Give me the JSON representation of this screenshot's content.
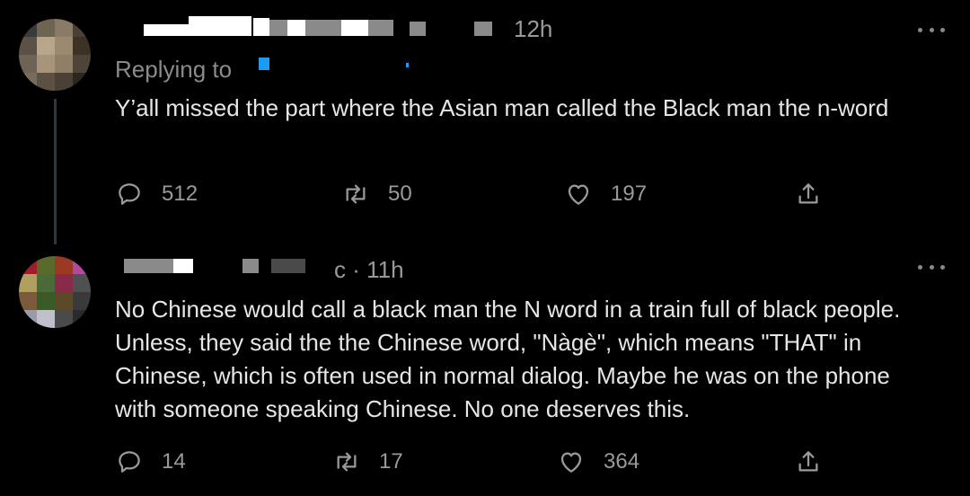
{
  "colors": {
    "background": "#000000",
    "text": "#e6e6e6",
    "muted": "#9a9a9a",
    "accent": "#1d9bf0"
  },
  "tweets": [
    {
      "time": "12h",
      "replying_to": "Replying to",
      "text": "Y’all missed the part where the Asian man called the Black man the n-word",
      "actions": {
        "replies": "512",
        "retweets": "50",
        "likes": "197"
      }
    },
    {
      "time": "c · 11h",
      "text": "No Chinese would call a black man the N word in a train full of black people.  Unless, they said the the Chinese word, \"Nàgè\", which means \"THAT\" in Chinese, which is often used in normal dialog. Maybe he was on the phone with someone speaking Chinese.  No one deserves this.",
      "actions": {
        "replies": "14",
        "retweets": "17",
        "likes": "364"
      }
    }
  ],
  "icons": [
    "reply-icon",
    "retweet-icon",
    "like-icon",
    "share-icon",
    "more-icon"
  ]
}
